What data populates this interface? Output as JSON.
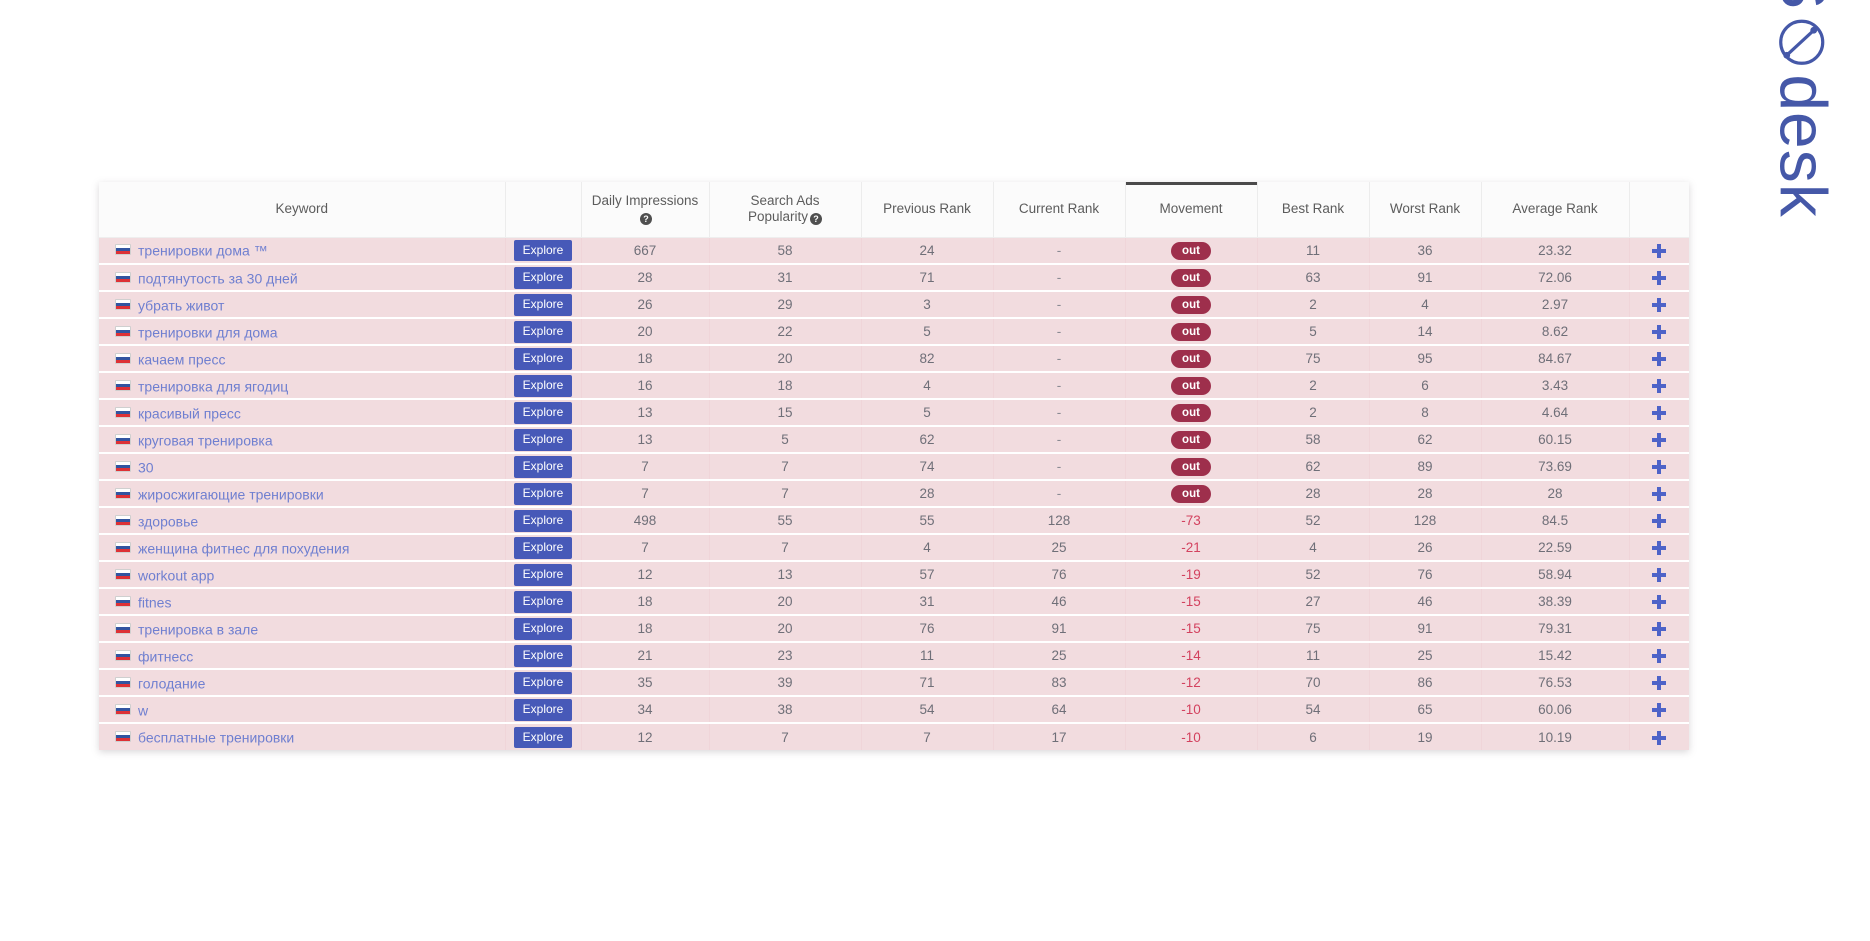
{
  "brand": {
    "logo_text_before": "AS",
    "logo_text_after": "desk",
    "logo_full": "ASOdesk",
    "logo_color": "#4558a8"
  },
  "table": {
    "headers": {
      "keyword": "Keyword",
      "explore": "",
      "daily_impressions": "Daily Impressions",
      "search_ads_popularity_line1": "Search Ads",
      "search_ads_popularity_line2": "Popularity",
      "previous_rank": "Previous Rank",
      "current_rank": "Current Rank",
      "movement": "Movement",
      "best_rank": "Best Rank",
      "worst_rank": "Worst Rank",
      "average_rank": "Average Rank",
      "add": ""
    },
    "sorted_column": "movement",
    "help_icon_glyph": "?",
    "explore_label": "Explore",
    "badge_out_label": "out",
    "empty_value": "-",
    "flag": "russia-flag",
    "colors": {
      "row_background": "#f2dcdf",
      "header_background": "#fbfbfb",
      "explore_button": "#4759b8",
      "badge_out": "#9e2f4c",
      "movement_negative": "#d3425f",
      "keyword_link": "#6f7fd0",
      "add_icon": "#4e63c8"
    },
    "rows": [
      {
        "keyword": "тренировки дома ™",
        "daily_impressions": "667",
        "search_ads_popularity": "58",
        "previous_rank": "24",
        "current_rank": "-",
        "movement": "out",
        "movement_type": "out",
        "best_rank": "11",
        "worst_rank": "36",
        "average_rank": "23.32"
      },
      {
        "keyword": "подтянутость за 30 дней",
        "daily_impressions": "28",
        "search_ads_popularity": "31",
        "previous_rank": "71",
        "current_rank": "-",
        "movement": "out",
        "movement_type": "out",
        "best_rank": "63",
        "worst_rank": "91",
        "average_rank": "72.06"
      },
      {
        "keyword": "убрать живот",
        "daily_impressions": "26",
        "search_ads_popularity": "29",
        "previous_rank": "3",
        "current_rank": "-",
        "movement": "out",
        "movement_type": "out",
        "best_rank": "2",
        "worst_rank": "4",
        "average_rank": "2.97"
      },
      {
        "keyword": "тренировки для дома",
        "daily_impressions": "20",
        "search_ads_popularity": "22",
        "previous_rank": "5",
        "current_rank": "-",
        "movement": "out",
        "movement_type": "out",
        "best_rank": "5",
        "worst_rank": "14",
        "average_rank": "8.62"
      },
      {
        "keyword": "качаем пресс",
        "daily_impressions": "18",
        "search_ads_popularity": "20",
        "previous_rank": "82",
        "current_rank": "-",
        "movement": "out",
        "movement_type": "out",
        "best_rank": "75",
        "worst_rank": "95",
        "average_rank": "84.67"
      },
      {
        "keyword": "тренировка для ягодиц",
        "daily_impressions": "16",
        "search_ads_popularity": "18",
        "previous_rank": "4",
        "current_rank": "-",
        "movement": "out",
        "movement_type": "out",
        "best_rank": "2",
        "worst_rank": "6",
        "average_rank": "3.43"
      },
      {
        "keyword": "красивый пресс",
        "daily_impressions": "13",
        "search_ads_popularity": "15",
        "previous_rank": "5",
        "current_rank": "-",
        "movement": "out",
        "movement_type": "out",
        "best_rank": "2",
        "worst_rank": "8",
        "average_rank": "4.64"
      },
      {
        "keyword": "круговая тренировка",
        "daily_impressions": "13",
        "search_ads_popularity": "5",
        "previous_rank": "62",
        "current_rank": "-",
        "movement": "out",
        "movement_type": "out",
        "best_rank": "58",
        "worst_rank": "62",
        "average_rank": "60.15"
      },
      {
        "keyword": "30",
        "daily_impressions": "7",
        "search_ads_popularity": "7",
        "previous_rank": "74",
        "current_rank": "-",
        "movement": "out",
        "movement_type": "out",
        "best_rank": "62",
        "worst_rank": "89",
        "average_rank": "73.69"
      },
      {
        "keyword": "жиросжигающие тренировки",
        "daily_impressions": "7",
        "search_ads_popularity": "7",
        "previous_rank": "28",
        "current_rank": "-",
        "movement": "out",
        "movement_type": "out",
        "best_rank": "28",
        "worst_rank": "28",
        "average_rank": "28"
      },
      {
        "keyword": "здоровье",
        "daily_impressions": "498",
        "search_ads_popularity": "55",
        "previous_rank": "55",
        "current_rank": "128",
        "movement": "-73",
        "movement_type": "negative",
        "best_rank": "52",
        "worst_rank": "128",
        "average_rank": "84.5"
      },
      {
        "keyword": "женщина фитнес для похудения",
        "daily_impressions": "7",
        "search_ads_popularity": "7",
        "previous_rank": "4",
        "current_rank": "25",
        "movement": "-21",
        "movement_type": "negative",
        "best_rank": "4",
        "worst_rank": "26",
        "average_rank": "22.59"
      },
      {
        "keyword": "workout app",
        "daily_impressions": "12",
        "search_ads_popularity": "13",
        "previous_rank": "57",
        "current_rank": "76",
        "movement": "-19",
        "movement_type": "negative",
        "best_rank": "52",
        "worst_rank": "76",
        "average_rank": "58.94"
      },
      {
        "keyword": "fitnes",
        "daily_impressions": "18",
        "search_ads_popularity": "20",
        "previous_rank": "31",
        "current_rank": "46",
        "movement": "-15",
        "movement_type": "negative",
        "best_rank": "27",
        "worst_rank": "46",
        "average_rank": "38.39"
      },
      {
        "keyword": "тренировка в зале",
        "daily_impressions": "18",
        "search_ads_popularity": "20",
        "previous_rank": "76",
        "current_rank": "91",
        "movement": "-15",
        "movement_type": "negative",
        "best_rank": "75",
        "worst_rank": "91",
        "average_rank": "79.31"
      },
      {
        "keyword": "фитнесс",
        "daily_impressions": "21",
        "search_ads_popularity": "23",
        "previous_rank": "11",
        "current_rank": "25",
        "movement": "-14",
        "movement_type": "negative",
        "best_rank": "11",
        "worst_rank": "25",
        "average_rank": "15.42"
      },
      {
        "keyword": "голодание",
        "daily_impressions": "35",
        "search_ads_popularity": "39",
        "previous_rank": "71",
        "current_rank": "83",
        "movement": "-12",
        "movement_type": "negative",
        "best_rank": "70",
        "worst_rank": "86",
        "average_rank": "76.53"
      },
      {
        "keyword": "w",
        "daily_impressions": "34",
        "search_ads_popularity": "38",
        "previous_rank": "54",
        "current_rank": "64",
        "movement": "-10",
        "movement_type": "negative",
        "best_rank": "54",
        "worst_rank": "65",
        "average_rank": "60.06"
      },
      {
        "keyword": "бесплатные тренировки",
        "daily_impressions": "12",
        "search_ads_popularity": "7",
        "previous_rank": "7",
        "current_rank": "17",
        "movement": "-10",
        "movement_type": "negative",
        "best_rank": "6",
        "worst_rank": "19",
        "average_rank": "10.19"
      }
    ]
  }
}
